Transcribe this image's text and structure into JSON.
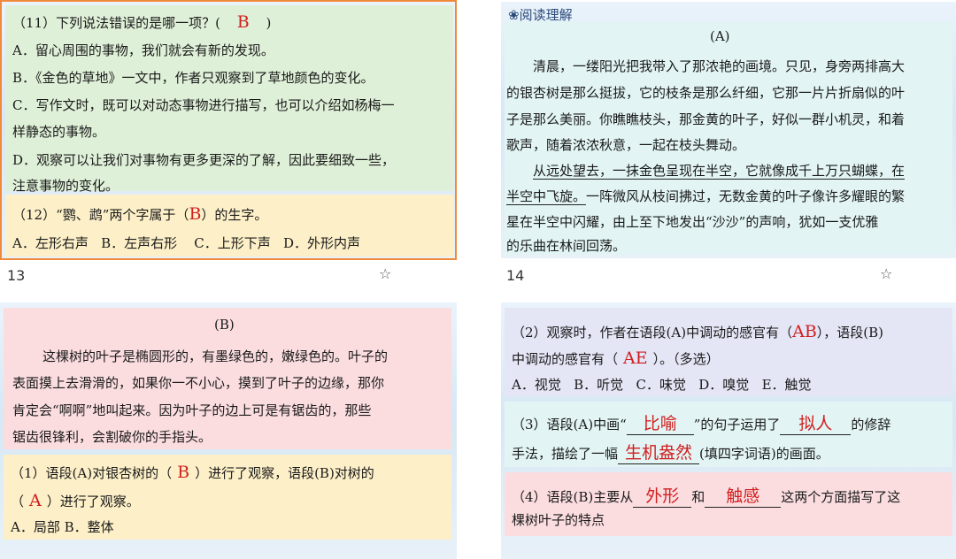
{
  "slide13": {
    "number": "13",
    "q11": {
      "stem_pre": "（11）下列说法错误的是哪一项？(",
      "answer": "B",
      "stem_post": ")",
      "opt_a": "A．留心周围的事物，我们就会有新的发现。",
      "opt_b": "B．《金色的草地》一文中，作者只观察到了草地颜色的变化。",
      "opt_c1": "C．写作文时，既可以对动态事物进行描写，也可以介绍如杨梅一",
      "opt_c2": "样静态的事物。",
      "opt_d1": "D．观察可以让我们对事物有更多更深的了解，因此要细致一些，",
      "opt_d2": "注意事物的变化。"
    },
    "q12": {
      "stem_pre": "（12）“鹦、鹉”两个字属于（",
      "answer": "B",
      "stem_post": "）的生字。",
      "options": "A．左形右声   B．左声右形    C．上形下声   D．外形内声"
    }
  },
  "slide14": {
    "number": "14",
    "header": "❀阅读理解",
    "title": "(A)",
    "lines": [
      "清晨，一缕阳光把我带入了那浓艳的画境。只见，身旁两排高大",
      "的银杏树是那么挺拔，它的枝条是那么纤细，它那一片片折扇似的叶",
      "子是那么美丽。你瞧瞧枝头，那金黄的叶子，好似一群小机灵，和着",
      "歌声，随着浓浓秋意，一起在枝头舞动。"
    ],
    "underlined1": "从远处望去，一抹金色呈现在半空，它就像成千上万只蝴蝶，在",
    "underlined2": "半空中飞旋。",
    "rest2": "一阵微风从枝间拂过，无数金黄的叶子像许多耀眼的繁",
    "line3": "星在半空中闪耀，由上至下地发出“沙沙”的声响，犹如一支优雅",
    "line4": "的乐曲在林间回荡。"
  },
  "slide15": {
    "title": "(B)",
    "lines": [
      "这棵树的叶子是椭圆形的，有墨绿色的，嫩绿色的。叶子的",
      "表面摸上去滑滑的，如果你一不小心，摸到了叶子的边缘，那你",
      "肯定会“啊啊”地叫起来。因为叶子的边上可是有锯齿的，那些",
      "锯齿很锋利，会割破你的手指头。"
    ],
    "q1_pre": "（1）语段(A)对银杏树的（",
    "q1_ans1": "B",
    "q1_mid": "）进行了观察，语段(B)对树的",
    "q1_line2_pre": "（",
    "q1_ans2": "A",
    "q1_line2_post": "）进行了观察。",
    "q1_options": "A．局部 B．整体"
  },
  "slide16": {
    "q2_pre": "（2）观察时，作者在语段(A)中调动的感官有（",
    "q2_ans1": "AB",
    "q2_mid": "），语段(B)",
    "q2_line2_pre": "中调动的感官有（",
    "q2_ans2": "AE",
    "q2_line2_post": "）。（多选）",
    "q2_options": "A．视觉   B．听觉   C．味觉   D．嗅觉   E．触觉",
    "q3_pre": "（3）语段(A)中画“",
    "q3_ans1": "比喻",
    "q3_mid": "”的句子运用了",
    "q3_ans2": "拟人",
    "q3_post": "的修辞",
    "q3_line2_pre": "手法，描绘了一幅",
    "q3_ans3": "生机盎然",
    "q3_line2_post": "(填四字词语)的画面。",
    "q4_pre": "（4）语段(B)主要从",
    "q4_ans1": "外形",
    "q4_mid": "和",
    "q4_ans2": "触感",
    "q4_post": "这两个方面描写了这",
    "q4_line2": "棵树叶子的特点"
  },
  "colors": {
    "green_box": "#dff0d8",
    "yellow_box": "#fdf0c8",
    "cyan_box": "#e2f4f4",
    "pink_box": "#fbdde0",
    "lavender_box": "#e4e6f6",
    "answer_red": "#d21f1f",
    "selected_border": "#f08a3a"
  },
  "icons": {
    "star": "star-outline-icon",
    "flower": "flower-icon"
  }
}
